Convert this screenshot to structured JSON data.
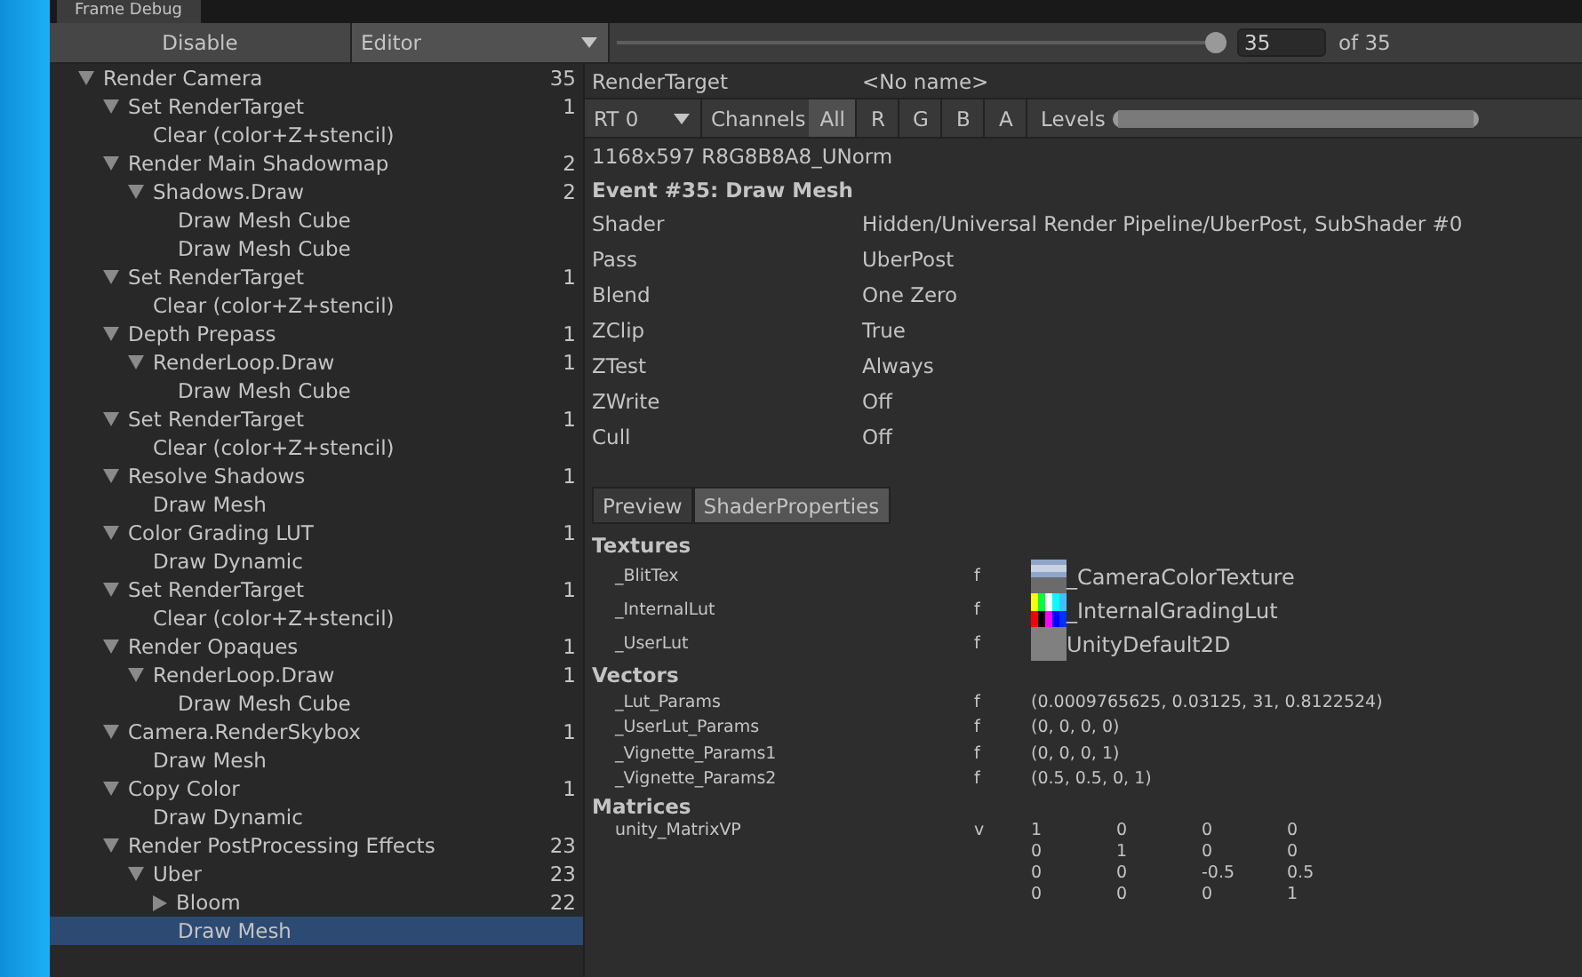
{
  "window": {
    "title": "Frame Debug"
  },
  "toolbar": {
    "disable_button": "Disable",
    "target_dropdown": "Editor",
    "event_slider": {
      "level": 1
    },
    "event_field": "35",
    "event_total": "of 35"
  },
  "tree": [
    {
      "label": "Render Camera",
      "count": "35",
      "expanded": true,
      "selected": false,
      "children": [
        {
          "label": "Set RenderTarget",
          "count": "1",
          "expanded": true,
          "selected": false,
          "children": [
            {
              "label": "Clear (color+Z+stencil)",
              "selected": false
            }
          ]
        },
        {
          "label": "Render Main Shadowmap",
          "count": "2",
          "expanded": true,
          "selected": false,
          "children": [
            {
              "label": "Shadows.Draw",
              "count": "2",
              "expanded": true,
              "selected": false,
              "children": [
                {
                  "label": "Draw Mesh Cube",
                  "selected": false
                },
                {
                  "label": "Draw Mesh Cube",
                  "selected": false
                }
              ]
            }
          ]
        },
        {
          "label": "Set RenderTarget",
          "count": "1",
          "expanded": true,
          "selected": false,
          "children": [
            {
              "label": "Clear (color+Z+stencil)",
              "selected": false
            }
          ]
        },
        {
          "label": "Depth Prepass",
          "count": "1",
          "expanded": true,
          "selected": false,
          "children": [
            {
              "label": "RenderLoop.Draw",
              "count": "1",
              "expanded": true,
              "selected": false,
              "children": [
                {
                  "label": "Draw Mesh Cube",
                  "selected": false
                }
              ]
            }
          ]
        },
        {
          "label": "Set RenderTarget",
          "count": "1",
          "expanded": true,
          "selected": false,
          "children": [
            {
              "label": "Clear (color+Z+stencil)",
              "selected": false
            }
          ]
        },
        {
          "label": "Resolve Shadows",
          "count": "1",
          "expanded": true,
          "selected": false,
          "children": [
            {
              "label": "Draw Mesh",
              "selected": false
            }
          ]
        },
        {
          "label": "Color Grading LUT",
          "count": "1",
          "expanded": true,
          "selected": false,
          "children": [
            {
              "label": "Draw Dynamic",
              "selected": false
            }
          ]
        },
        {
          "label": "Set RenderTarget",
          "count": "1",
          "expanded": true,
          "selected": false,
          "children": [
            {
              "label": "Clear (color+Z+stencil)",
              "selected": false
            }
          ]
        },
        {
          "label": "Render Opaques",
          "count": "1",
          "expanded": true,
          "selected": false,
          "children": [
            {
              "label": "RenderLoop.Draw",
              "count": "1",
              "expanded": true,
              "selected": false,
              "children": [
                {
                  "label": "Draw Mesh Cube",
                  "selected": false
                }
              ]
            }
          ]
        },
        {
          "label": "Camera.RenderSkybox",
          "count": "1",
          "expanded": true,
          "selected": false,
          "children": [
            {
              "label": "Draw Mesh",
              "selected": false
            }
          ]
        },
        {
          "label": "Copy Color",
          "count": "1",
          "expanded": true,
          "selected": false,
          "children": [
            {
              "label": "Draw Dynamic",
              "selected": false
            }
          ]
        },
        {
          "label": "Render PostProcessing Effects",
          "count": "23",
          "expanded": true,
          "selected": false,
          "children": [
            {
              "label": "Uber",
              "count": "23",
              "expanded": true,
              "selected": false,
              "children": [
                {
                  "label": "Bloom",
                  "count": "22",
                  "expanded": false,
                  "selected": false
                },
                {
                  "label": "Draw Mesh",
                  "selected": true
                }
              ]
            }
          ]
        }
      ]
    }
  ],
  "render_target": {
    "label": "RenderTarget",
    "value": "<No name>",
    "rt_dropdown": "RT 0",
    "channels_label": "Channels",
    "channels": [
      {
        "label": "All",
        "selected": true
      },
      {
        "label": "R",
        "selected": false
      },
      {
        "label": "G",
        "selected": false
      },
      {
        "label": "B",
        "selected": false
      },
      {
        "label": "A",
        "selected": false
      }
    ],
    "levels_label": "Levels",
    "levels": {
      "level": 1
    },
    "format": "1168x597 R8G8B8A8_UNorm"
  },
  "event": {
    "title": "Event #35: Draw Mesh",
    "properties": [
      {
        "name": "Shader",
        "value": "Hidden/Universal Render Pipeline/UberPost, SubShader #0"
      },
      {
        "name": "Pass",
        "value": "UberPost"
      },
      {
        "name": "Blend",
        "value": "One Zero"
      },
      {
        "name": "ZClip",
        "value": "True"
      },
      {
        "name": "ZTest",
        "value": "Always"
      },
      {
        "name": "ZWrite",
        "value": "Off"
      },
      {
        "name": "Cull",
        "value": "Off"
      }
    ]
  },
  "tabs": [
    {
      "label": "Preview",
      "selected": false
    },
    {
      "label": "ShaderProperties",
      "selected": true
    }
  ],
  "textures": {
    "title": "Textures",
    "items": [
      {
        "name": "_BlitTex",
        "type": "f",
        "kind": "sky",
        "value": "_CameraColorTexture"
      },
      {
        "name": "_InternalLut",
        "type": "f",
        "kind": "lut",
        "value": "_InternalGradingLut"
      },
      {
        "name": "_UserLut",
        "type": "f",
        "kind": "gray",
        "value": "UnityDefault2D"
      }
    ]
  },
  "vectors": {
    "title": "Vectors",
    "items": [
      {
        "name": "_Lut_Params",
        "type": "f",
        "value": "(0.0009765625, 0.03125, 31, 0.8122524)"
      },
      {
        "name": "_UserLut_Params",
        "type": "f",
        "value": "(0, 0, 0, 0)"
      },
      {
        "name": "_Vignette_Params1",
        "type": "f",
        "value": "(0, 0, 0, 1)"
      },
      {
        "name": "_Vignette_Params2",
        "type": "f",
        "value": "(0.5, 0.5, 0, 1)"
      }
    ]
  },
  "matrices": {
    "title": "Matrices",
    "items": [
      {
        "name": "unity_MatrixVP",
        "type": "v",
        "rows": [
          [
            "1",
            "0",
            "0",
            "0"
          ],
          [
            "0",
            "1",
            "0",
            "0"
          ],
          [
            "0",
            "0",
            "-0.5",
            "0.5"
          ],
          [
            "0",
            "0",
            "0",
            "1"
          ]
        ]
      }
    ]
  }
}
